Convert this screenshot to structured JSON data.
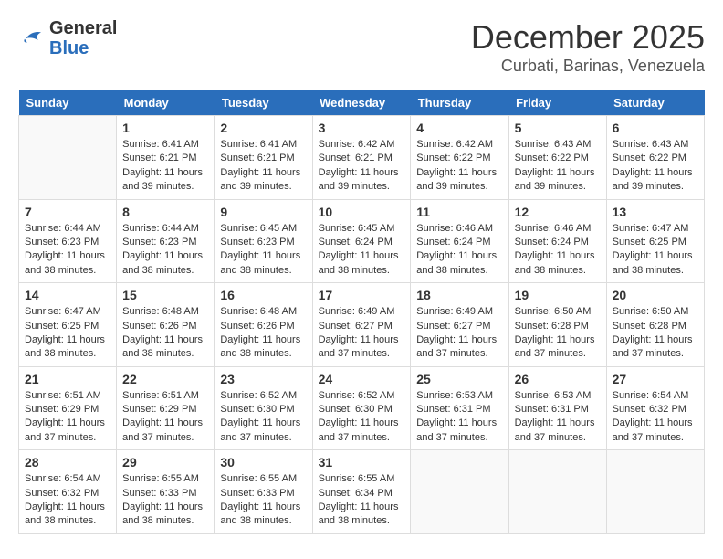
{
  "header": {
    "logo_line1": "General",
    "logo_line2": "Blue",
    "month": "December 2025",
    "location": "Curbati, Barinas, Venezuela"
  },
  "weekdays": [
    "Sunday",
    "Monday",
    "Tuesday",
    "Wednesday",
    "Thursday",
    "Friday",
    "Saturday"
  ],
  "weeks": [
    [
      {
        "day": "",
        "info": ""
      },
      {
        "day": "1",
        "info": "Sunrise: 6:41 AM\nSunset: 6:21 PM\nDaylight: 11 hours and 39 minutes."
      },
      {
        "day": "2",
        "info": "Sunrise: 6:41 AM\nSunset: 6:21 PM\nDaylight: 11 hours and 39 minutes."
      },
      {
        "day": "3",
        "info": "Sunrise: 6:42 AM\nSunset: 6:21 PM\nDaylight: 11 hours and 39 minutes."
      },
      {
        "day": "4",
        "info": "Sunrise: 6:42 AM\nSunset: 6:22 PM\nDaylight: 11 hours and 39 minutes."
      },
      {
        "day": "5",
        "info": "Sunrise: 6:43 AM\nSunset: 6:22 PM\nDaylight: 11 hours and 39 minutes."
      },
      {
        "day": "6",
        "info": "Sunrise: 6:43 AM\nSunset: 6:22 PM\nDaylight: 11 hours and 39 minutes."
      }
    ],
    [
      {
        "day": "7",
        "info": "Sunrise: 6:44 AM\nSunset: 6:23 PM\nDaylight: 11 hours and 38 minutes."
      },
      {
        "day": "8",
        "info": "Sunrise: 6:44 AM\nSunset: 6:23 PM\nDaylight: 11 hours and 38 minutes."
      },
      {
        "day": "9",
        "info": "Sunrise: 6:45 AM\nSunset: 6:23 PM\nDaylight: 11 hours and 38 minutes."
      },
      {
        "day": "10",
        "info": "Sunrise: 6:45 AM\nSunset: 6:24 PM\nDaylight: 11 hours and 38 minutes."
      },
      {
        "day": "11",
        "info": "Sunrise: 6:46 AM\nSunset: 6:24 PM\nDaylight: 11 hours and 38 minutes."
      },
      {
        "day": "12",
        "info": "Sunrise: 6:46 AM\nSunset: 6:24 PM\nDaylight: 11 hours and 38 minutes."
      },
      {
        "day": "13",
        "info": "Sunrise: 6:47 AM\nSunset: 6:25 PM\nDaylight: 11 hours and 38 minutes."
      }
    ],
    [
      {
        "day": "14",
        "info": "Sunrise: 6:47 AM\nSunset: 6:25 PM\nDaylight: 11 hours and 38 minutes."
      },
      {
        "day": "15",
        "info": "Sunrise: 6:48 AM\nSunset: 6:26 PM\nDaylight: 11 hours and 38 minutes."
      },
      {
        "day": "16",
        "info": "Sunrise: 6:48 AM\nSunset: 6:26 PM\nDaylight: 11 hours and 38 minutes."
      },
      {
        "day": "17",
        "info": "Sunrise: 6:49 AM\nSunset: 6:27 PM\nDaylight: 11 hours and 37 minutes."
      },
      {
        "day": "18",
        "info": "Sunrise: 6:49 AM\nSunset: 6:27 PM\nDaylight: 11 hours and 37 minutes."
      },
      {
        "day": "19",
        "info": "Sunrise: 6:50 AM\nSunset: 6:28 PM\nDaylight: 11 hours and 37 minutes."
      },
      {
        "day": "20",
        "info": "Sunrise: 6:50 AM\nSunset: 6:28 PM\nDaylight: 11 hours and 37 minutes."
      }
    ],
    [
      {
        "day": "21",
        "info": "Sunrise: 6:51 AM\nSunset: 6:29 PM\nDaylight: 11 hours and 37 minutes."
      },
      {
        "day": "22",
        "info": "Sunrise: 6:51 AM\nSunset: 6:29 PM\nDaylight: 11 hours and 37 minutes."
      },
      {
        "day": "23",
        "info": "Sunrise: 6:52 AM\nSunset: 6:30 PM\nDaylight: 11 hours and 37 minutes."
      },
      {
        "day": "24",
        "info": "Sunrise: 6:52 AM\nSunset: 6:30 PM\nDaylight: 11 hours and 37 minutes."
      },
      {
        "day": "25",
        "info": "Sunrise: 6:53 AM\nSunset: 6:31 PM\nDaylight: 11 hours and 37 minutes."
      },
      {
        "day": "26",
        "info": "Sunrise: 6:53 AM\nSunset: 6:31 PM\nDaylight: 11 hours and 37 minutes."
      },
      {
        "day": "27",
        "info": "Sunrise: 6:54 AM\nSunset: 6:32 PM\nDaylight: 11 hours and 37 minutes."
      }
    ],
    [
      {
        "day": "28",
        "info": "Sunrise: 6:54 AM\nSunset: 6:32 PM\nDaylight: 11 hours and 38 minutes."
      },
      {
        "day": "29",
        "info": "Sunrise: 6:55 AM\nSunset: 6:33 PM\nDaylight: 11 hours and 38 minutes."
      },
      {
        "day": "30",
        "info": "Sunrise: 6:55 AM\nSunset: 6:33 PM\nDaylight: 11 hours and 38 minutes."
      },
      {
        "day": "31",
        "info": "Sunrise: 6:55 AM\nSunset: 6:34 PM\nDaylight: 11 hours and 38 minutes."
      },
      {
        "day": "",
        "info": ""
      },
      {
        "day": "",
        "info": ""
      },
      {
        "day": "",
        "info": ""
      }
    ]
  ]
}
